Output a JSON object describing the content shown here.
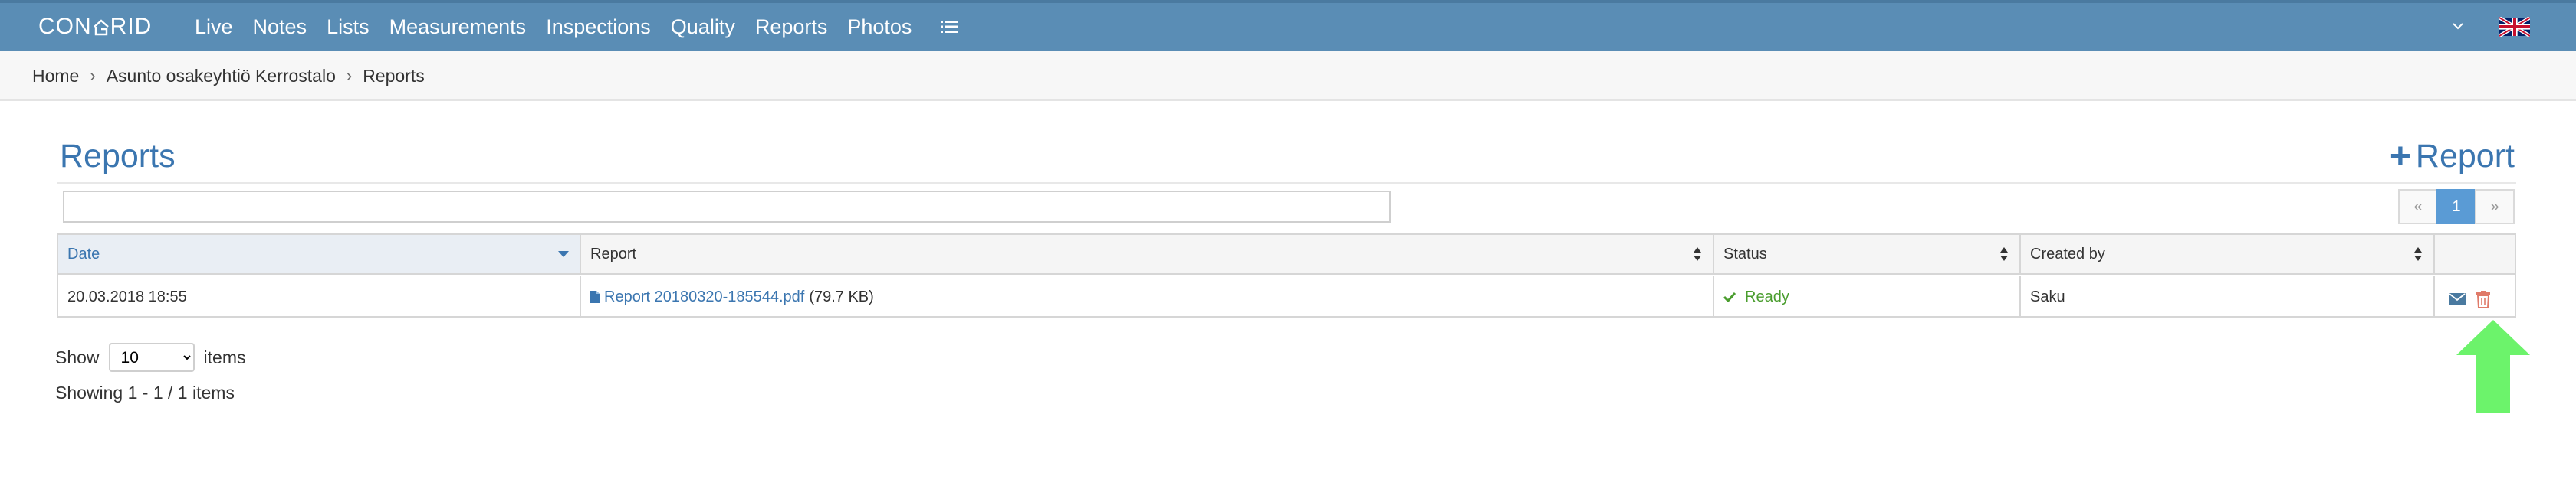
{
  "app": {
    "logo_text_before": "CON",
    "logo_text_after": "RID",
    "brand_color": "#5a8db5",
    "accent_color": "#3b76b0"
  },
  "nav": {
    "items": [
      "Live",
      "Notes",
      "Lists",
      "Measurements",
      "Inspections",
      "Quality",
      "Reports",
      "Photos"
    ],
    "menu_icon": "list-icon",
    "language_icon": "uk-flag-icon"
  },
  "breadcrumb": [
    "Home",
    "Asunto osakeyhtiö Kerrostalo",
    "Reports"
  ],
  "page": {
    "title": "Reports",
    "add_button_label": "Report",
    "search_value": "",
    "search_placeholder": ""
  },
  "pager": {
    "prev": "«",
    "current": "1",
    "next": "»"
  },
  "table": {
    "columns": [
      "Date",
      "Report",
      "Status",
      "Created by"
    ],
    "sorted_column": "Date",
    "rows": [
      {
        "date": "20.03.2018 18:55",
        "report_name": "Report 20180320-185544.pdf",
        "report_size": "(79.7 KB)",
        "status": "Ready",
        "created_by": "Saku"
      }
    ]
  },
  "footer": {
    "show_label": "Show",
    "page_size": "10",
    "page_size_options": [
      "10"
    ],
    "items_label": "items",
    "summary": "Showing 1 - 1 / 1 items"
  },
  "annotation": {
    "arrow_color": "#6cf36b"
  }
}
